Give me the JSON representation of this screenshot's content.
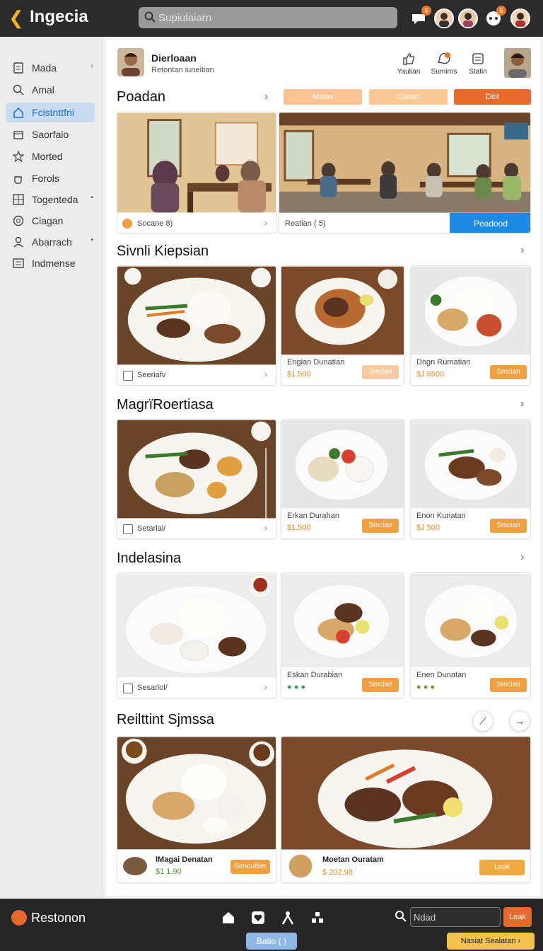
{
  "app": {
    "title": "Ingecia",
    "search_placeholder": "Supiulaiarn"
  },
  "topbar": {
    "badges": [
      "6",
      "5"
    ]
  },
  "sidebar": {
    "items": [
      {
        "label": "Mada",
        "icon": "document-icon",
        "caret": "›"
      },
      {
        "label": "Amal",
        "icon": "search-icon",
        "caret": ""
      },
      {
        "label": "Fcistnttfni",
        "icon": "home-icon",
        "caret": ""
      },
      {
        "label": "Saorfaio",
        "icon": "box-icon",
        "caret": ""
      },
      {
        "label": "Morted",
        "icon": "star-icon",
        "caret": ""
      },
      {
        "label": "Forols",
        "icon": "cup-icon",
        "caret": ""
      },
      {
        "label": "Togenteda",
        "icon": "grid-icon",
        "caret": "•"
      },
      {
        "label": "Ciagan",
        "icon": "target-icon",
        "caret": ""
      },
      {
        "label": "Abarrach",
        "icon": "user-icon",
        "caret": "•"
      },
      {
        "label": "Indmense",
        "icon": "list-icon",
        "caret": ""
      }
    ]
  },
  "profile": {
    "name": "Dierloaan",
    "subtitle": "Retontan iuneitian"
  },
  "actions": [
    {
      "label": "Yaulian",
      "icon": "like-icon"
    },
    {
      "label": "Sumirns",
      "icon": "chat-icon"
    },
    {
      "label": "Statin",
      "icon": "calendar-icon"
    }
  ],
  "section1": {
    "title": "Poadan",
    "pills": [
      "Maaw",
      "Coaan",
      "Ditit"
    ],
    "card1": {
      "label": "Socane 8)"
    },
    "card2": {
      "label": "Reatian ( 5)",
      "button": "Peadood"
    }
  },
  "section2": {
    "title": "Sivnli Kiepsian",
    "items": [
      {
        "label": "Seeriafv"
      },
      {
        "name": "Engian Dunatian",
        "price": "$1.500",
        "button": "Smcian"
      },
      {
        "name": "Dngn Rumatian",
        "price": "$J 6500",
        "button": "Smcian"
      }
    ]
  },
  "section3": {
    "title": "MagrïRoertiasa",
    "items": [
      {
        "label": "Setarlal/"
      },
      {
        "name": "Erkan Durahan",
        "price": "$1,500",
        "button": "Smcian"
      },
      {
        "name": "Enon Kunatan",
        "price": "$J 500",
        "button": "Smcian"
      }
    ]
  },
  "section4": {
    "title": "Indelasina",
    "items": [
      {
        "label": "Sesarlol/"
      },
      {
        "name": "Eskan Durabian",
        "price": "● ● ●",
        "button": "Smcian"
      },
      {
        "name": "Enen Dunatan",
        "price": "● ● ●",
        "button": "Smcian"
      }
    ]
  },
  "section5": {
    "title": "Reilttint Sjmssa",
    "items": [
      {
        "name": "lMagai Denatan",
        "price": "$1 1.90",
        "button": "Senouttier"
      },
      {
        "name": "Moetan Ouratam",
        "price": "$ 202.98",
        "button": "Look"
      }
    ]
  },
  "bottombar": {
    "title": "Restonon",
    "search_placeholder": "Ndad",
    "go": "Leak",
    "chip": "Batio (",
    "chip_icon": ")",
    "cta": "Nasiat Sealatan",
    "cta_arrow": "›"
  },
  "colors": {
    "accent_orange": "#f0a040",
    "accent_red": "#e8692e",
    "accent_blue": "#1e88e5"
  }
}
